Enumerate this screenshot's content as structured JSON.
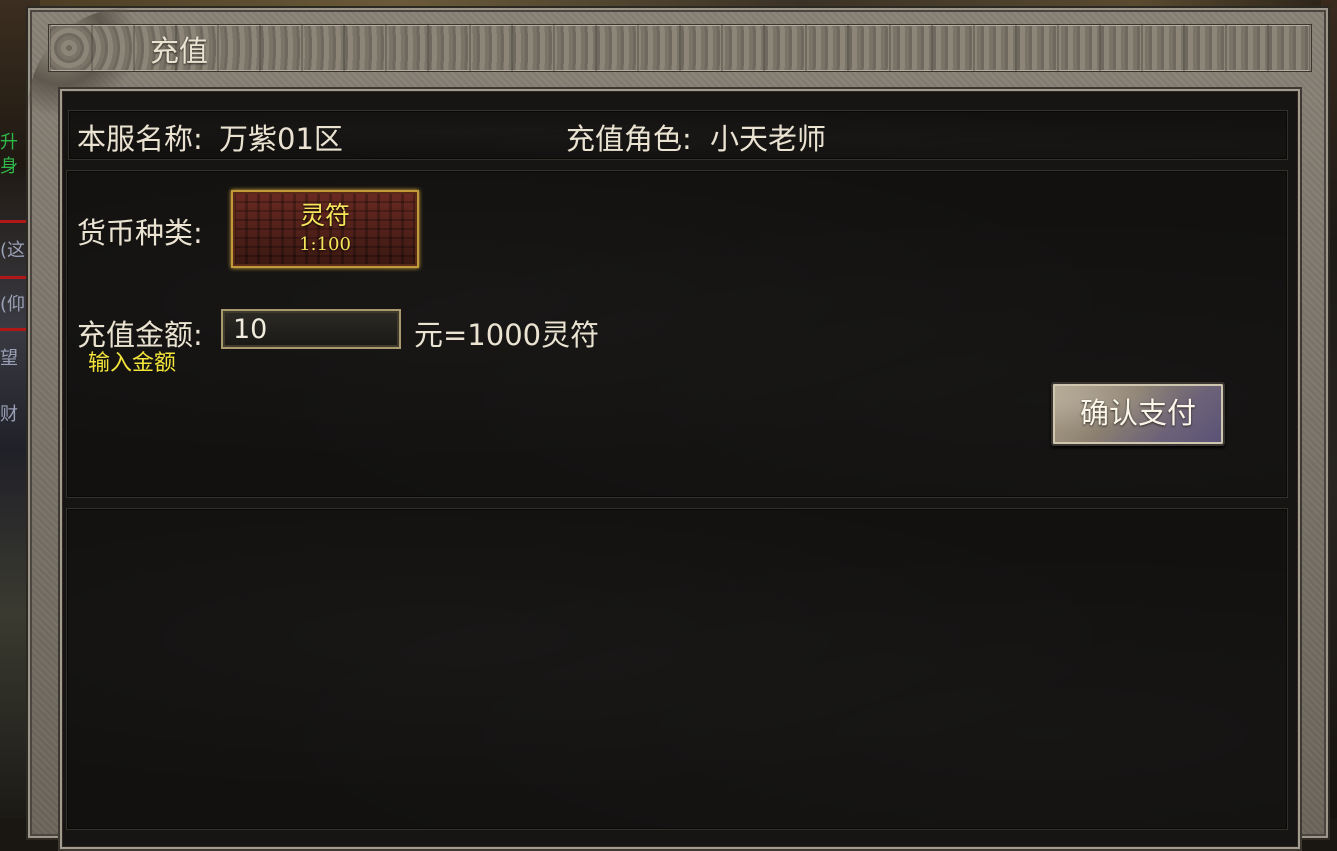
{
  "window": {
    "title": "充值"
  },
  "info": {
    "server_label": "本服名称:",
    "server_name": "万紫01区",
    "role_label": "充值角色:",
    "role_name": "小天老师"
  },
  "form": {
    "currency_label": "货币种类:",
    "currency_option": {
      "name": "灵符",
      "rate": "1:100",
      "selected": true
    },
    "amount_label": "充值金额:",
    "amount_hint": "输入金额",
    "amount_value": "10",
    "conversion_text": "元=1000灵符",
    "confirm_label": "确认支付"
  },
  "background_fragments": [
    "升",
    "身",
    "(这",
    "(仰",
    "望",
    "财"
  ],
  "colors": {
    "hint_yellow": "#f2e43a",
    "currency_gold": "#f6e55a",
    "text_light": "#ebe3d2",
    "panel_dark": "#121110",
    "frame_stone": "#857e72"
  }
}
